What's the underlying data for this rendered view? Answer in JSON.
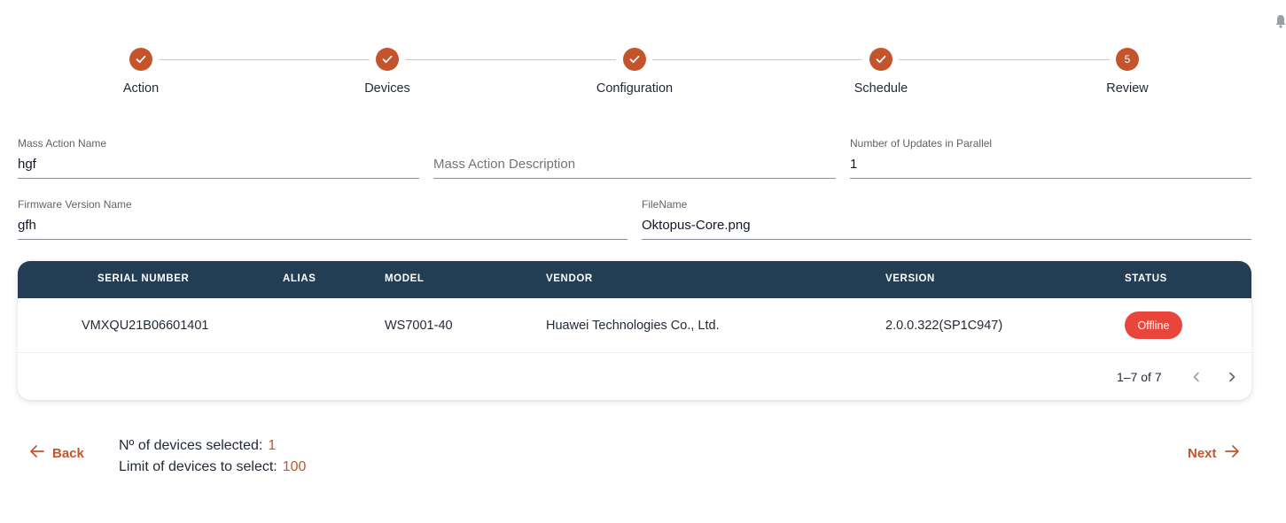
{
  "stepper": {
    "steps": [
      {
        "label": "Action",
        "state": "done"
      },
      {
        "label": "Devices",
        "state": "done"
      },
      {
        "label": "Configuration",
        "state": "done"
      },
      {
        "label": "Schedule",
        "state": "done"
      },
      {
        "label": "Review",
        "state": "active",
        "number": "5"
      }
    ]
  },
  "form": {
    "mass_action_name": {
      "label": "Mass Action Name",
      "value": "hgf"
    },
    "mass_action_description": {
      "placeholder": "Mass Action Description"
    },
    "updates_parallel": {
      "label": "Number of Updates in Parallel",
      "value": "1"
    },
    "firmware_version_name": {
      "label": "Firmware Version Name",
      "value": "gfh"
    },
    "file_name": {
      "label": "FileName",
      "value": "Oktopus-Core.png"
    }
  },
  "table": {
    "headers": {
      "serial": "SERIAL NUMBER",
      "alias": "ALIAS",
      "model": "MODEL",
      "vendor": "VENDOR",
      "version": "VERSION",
      "status": "STATUS"
    },
    "rows": [
      {
        "serial": "VMXQU21B06601401",
        "alias": "",
        "model": "WS7001-40",
        "vendor": "Huawei Technologies Co., Ltd.",
        "version": "2.0.0.322(SP1C947)",
        "status": "Offline"
      }
    ],
    "pagination": "1–7 of 7"
  },
  "footer": {
    "back_label": "Back",
    "next_label": "Next",
    "devices_selected_label": "Nº of devices selected:",
    "devices_selected_value": "1",
    "limit_label": "Limit of devices to select:",
    "limit_value": "100"
  },
  "colors": {
    "accent": "#c4542b",
    "table_header": "#233d55",
    "status_offline": "#e8453c"
  },
  "icons": [
    "check-icon",
    "arrow-left-icon",
    "arrow-right-icon",
    "chevron-left-icon",
    "chevron-right-icon",
    "bell-icon"
  ]
}
